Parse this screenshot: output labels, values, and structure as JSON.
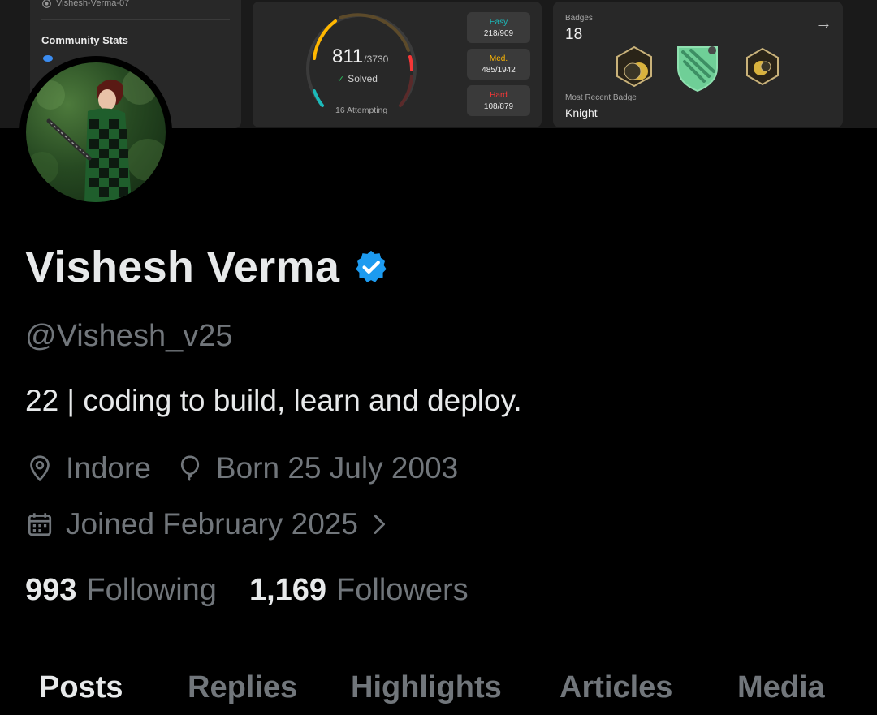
{
  "banner": {
    "repo": "Vishesh-Verma-07",
    "community_stats": "Community Stats",
    "solved": "811",
    "total": "/3730",
    "solved_label": "Solved",
    "attempting": "16 Attempting",
    "difficulty": [
      {
        "name": "Easy",
        "value": "218/909",
        "color": "#1cbaba"
      },
      {
        "name": "Med.",
        "value": "485/1942",
        "color": "#ffb700"
      },
      {
        "name": "Hard",
        "value": "108/879",
        "color": "#f63737"
      }
    ],
    "badges_title": "Badges",
    "badges_count": "18",
    "recent_badge_label": "Most Recent Badge",
    "recent_badge_name": "Knight"
  },
  "profile": {
    "display_name": "Vishesh Verma",
    "handle": "@Vishesh_v25",
    "bio": "22 | coding to build, learn and deploy.",
    "location": "Indore",
    "birthday": "Born 25 July 2003",
    "joined": "Joined February 2025",
    "following_count": "993",
    "following_label": "Following",
    "followers_count": "1,169",
    "followers_label": "Followers"
  },
  "tabs": [
    {
      "label": "Posts",
      "active": true
    },
    {
      "label": "Replies"
    },
    {
      "label": "Highlights"
    },
    {
      "label": "Articles"
    },
    {
      "label": "Media"
    }
  ],
  "colors": {
    "verified": "#1d9bf0",
    "muted": "#71767b",
    "text": "#e7e9ea",
    "background": "#000000"
  },
  "icons": [
    "github-icon",
    "eye-icon",
    "check-icon",
    "arrow-right-icon",
    "verified-badge-icon",
    "location-pin-icon",
    "balloon-icon",
    "calendar-icon",
    "chevron-right-icon"
  ]
}
